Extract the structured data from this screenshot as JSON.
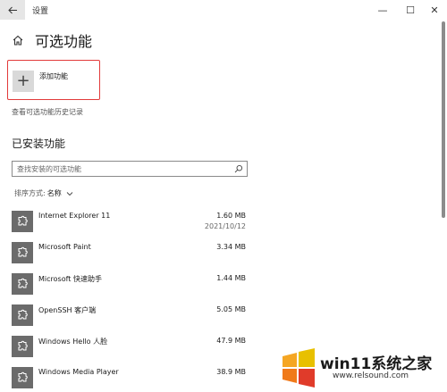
{
  "window": {
    "title": "设置",
    "back_icon": "arrow-left-icon",
    "minimize_glyph": "—",
    "maximize_glyph": "☐",
    "close_glyph": "✕"
  },
  "header": {
    "title": "可选功能",
    "home_icon": "home-icon"
  },
  "add_feature": {
    "label": "添加功能",
    "plus_glyph": "+",
    "highlight_color": "#e23a3a"
  },
  "history_link": "查看可选功能历史记录",
  "installed": {
    "section_title": "已安装功能",
    "search": {
      "placeholder": "查找安装的可选功能"
    },
    "sort": {
      "label": "排序方式:",
      "value": "名称"
    },
    "items": [
      {
        "name": "Internet Explorer 11",
        "size": "1.60 MB",
        "date": "2021/10/12"
      },
      {
        "name": "Microsoft Paint",
        "size": "3.34 MB",
        "date": ""
      },
      {
        "name": "Microsoft 快速助手",
        "size": "1.44 MB",
        "date": ""
      },
      {
        "name": "OpenSSH 客户端",
        "size": "5.05 MB",
        "date": ""
      },
      {
        "name": "Windows Hello 人脸",
        "size": "47.9 MB",
        "date": ""
      },
      {
        "name": "Windows Media Player",
        "size": "38.9 MB",
        "date": ""
      }
    ]
  },
  "watermark": {
    "text": "win11系统之家",
    "url": "www.relsound.com"
  }
}
